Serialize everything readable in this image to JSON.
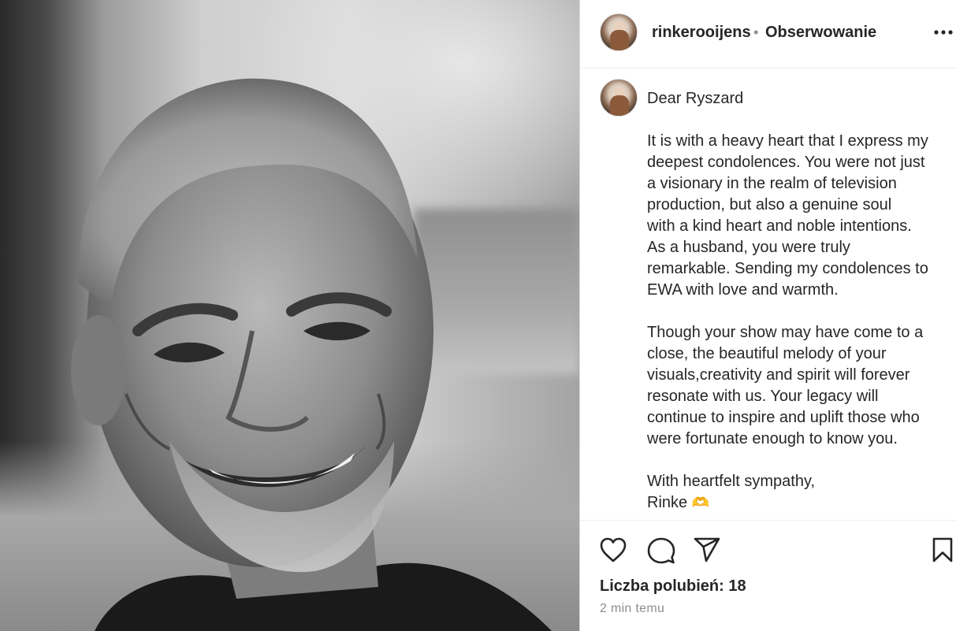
{
  "post": {
    "image_alt": "Black and white portrait of a smiling grey-haired man"
  },
  "header": {
    "username": "rinkerooijens",
    "separator": "•",
    "follow_label": "Obserwowanie",
    "more_icon": "more-horizontal-icon"
  },
  "comment": {
    "greeting": "Dear Ryszard",
    "paragraph1": "It is with a heavy heart that I express my\ndeepest condolences. You were not just\na visionary in the realm of television\nproduction, but also a genuine soul\nwith a kind heart and noble intentions.\nAs a husband, you were truly\nremarkable. Sending my condolences to\nEWA with love and warmth.",
    "paragraph2": "Though your show may have come to a\nclose, the beautiful melody of your\nvisuals,creativity and spirit will forever\nresonate with us. Your legacy will\ncontinue to inspire and uplift those who\nwere fortunate enough to know you.",
    "closing": "With heartfelt sympathy,",
    "signature": "Rinke",
    "signature_emoji": "🫶"
  },
  "actions": {
    "like_icon": "heart-icon",
    "comment_icon": "comment-bubble-icon",
    "share_icon": "paper-plane-icon",
    "save_icon": "bookmark-icon"
  },
  "likes": {
    "label": "Liczba polubień: 18"
  },
  "timestamp": "2 min temu"
}
